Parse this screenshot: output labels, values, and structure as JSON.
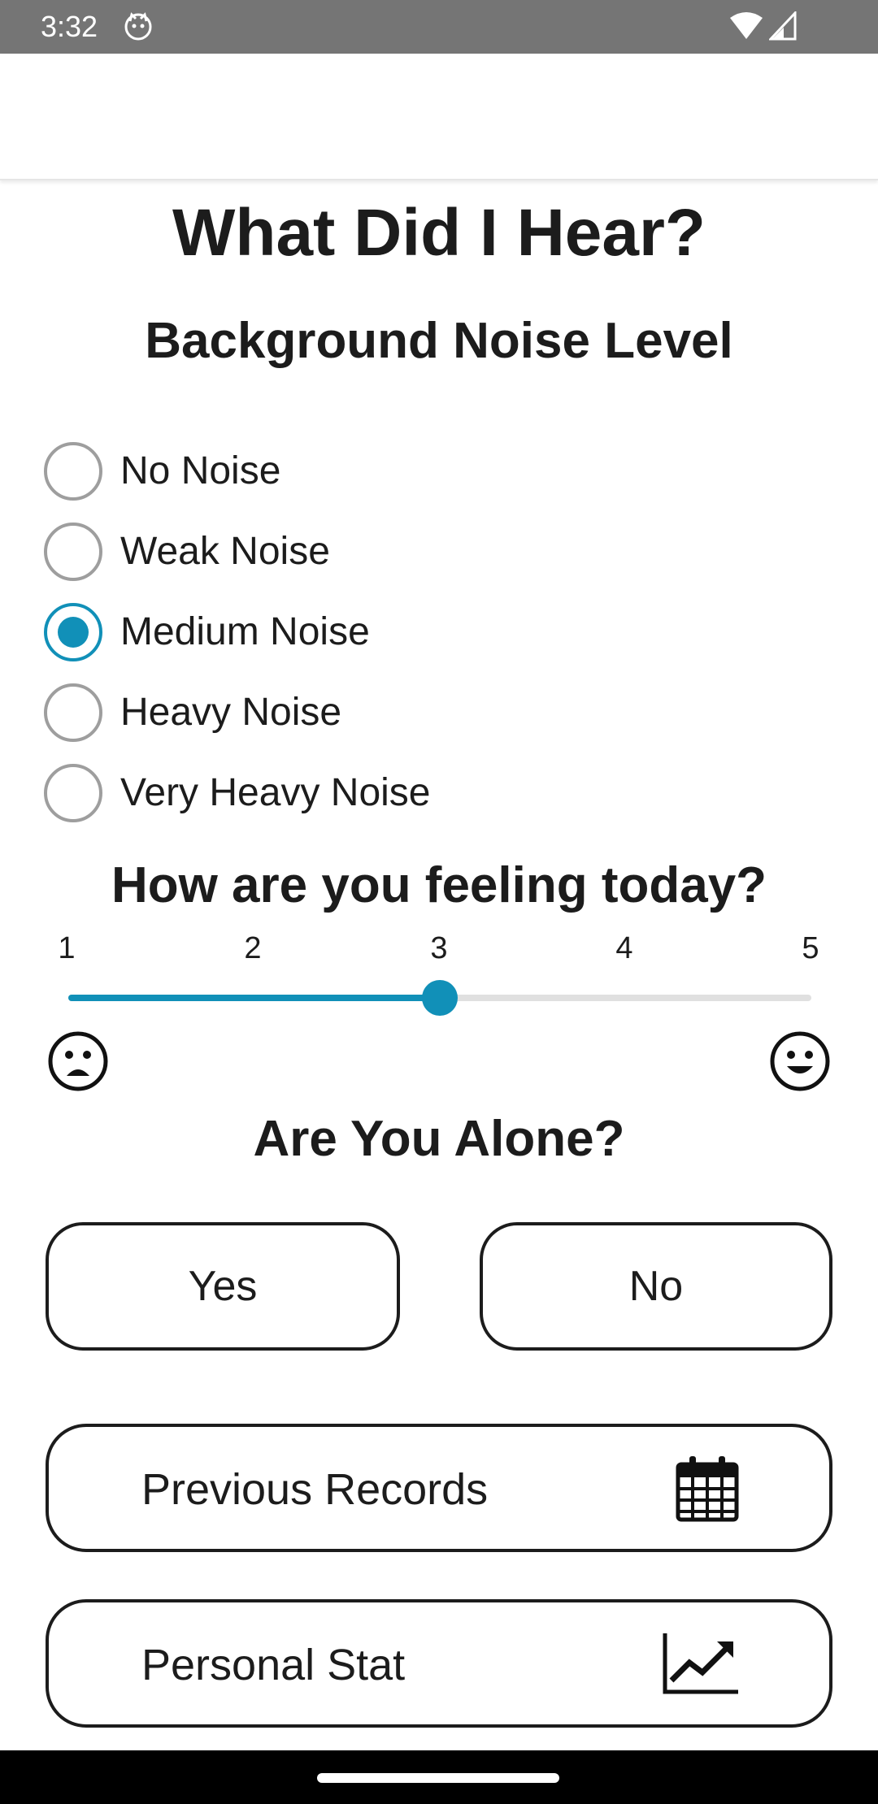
{
  "status_bar": {
    "time": "3:32"
  },
  "page": {
    "title": "What Did I Hear?",
    "noise_section_title": "Background Noise Level",
    "noise_options": [
      {
        "label": "No Noise",
        "checked": false
      },
      {
        "label": "Weak Noise",
        "checked": false
      },
      {
        "label": "Medium Noise",
        "checked": true
      },
      {
        "label": "Heavy Noise",
        "checked": false
      },
      {
        "label": "Very Heavy Noise",
        "checked": false
      }
    ],
    "feeling_title": "How are you feeling today?",
    "slider": {
      "ticks": [
        "1",
        "2",
        "3",
        "4",
        "5"
      ],
      "value": 3,
      "min": 1,
      "max": 5
    },
    "alone_title": "Are You Alone?",
    "yes_label": "Yes",
    "no_label": "No",
    "previous_records_label": "Previous Records",
    "personal_stat_label": "Personal Stat"
  },
  "colors": {
    "accent": "#1190b8",
    "status_bar": "#757575",
    "text": "#1c1c1c"
  },
  "icons": {
    "sad_face": "frowning-face-icon",
    "happy_face": "smiling-face-icon",
    "calendar": "calendar-icon",
    "stats": "trending-up-chart-icon"
  }
}
